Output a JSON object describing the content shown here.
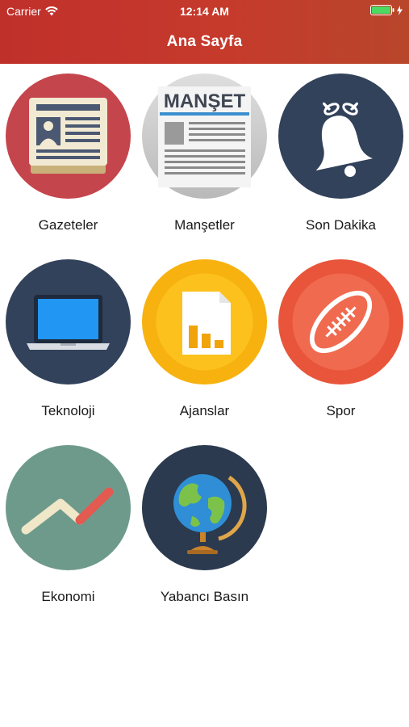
{
  "status_bar": {
    "carrier": "Carrier",
    "time": "12:14 AM"
  },
  "nav": {
    "title": "Ana Sayfa"
  },
  "tiles": [
    {
      "label": "Gazeteler",
      "icon": "newspaper-icon",
      "color": "#c5454d"
    },
    {
      "label": "Manşetler",
      "icon": "headlines-icon",
      "color": "#c9c9c9",
      "icon_text": "MANŞET"
    },
    {
      "label": "Son Dakika",
      "icon": "bell-icon",
      "color": "#33425b"
    },
    {
      "label": "Teknoloji",
      "icon": "laptop-icon",
      "color": "#33425b"
    },
    {
      "label": "Ajanslar",
      "icon": "document-chart-icon",
      "color": "#f7b20f"
    },
    {
      "label": "Spor",
      "icon": "football-icon",
      "color": "#e8553b"
    },
    {
      "label": "Ekonomi",
      "icon": "trend-icon",
      "color": "#6e9a8c"
    },
    {
      "label": "Yabancı Basın",
      "icon": "globe-icon",
      "color": "#2b3a4e"
    }
  ]
}
